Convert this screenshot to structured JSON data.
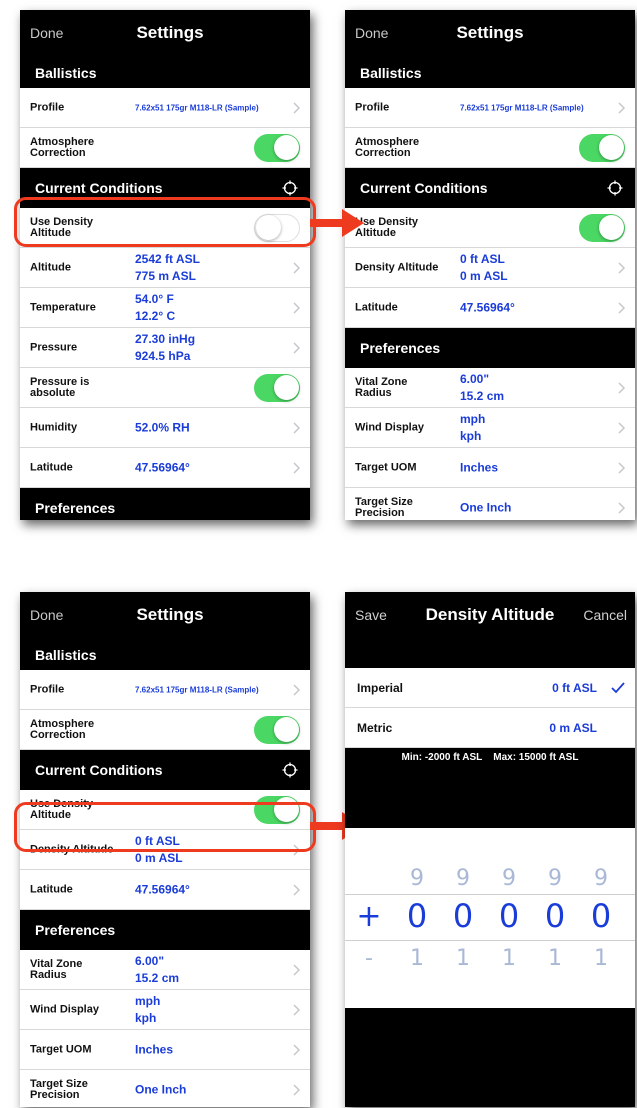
{
  "settings": {
    "done_label": "Done",
    "title": "Settings",
    "ballistics_header": "Ballistics",
    "profile_label": "Profile",
    "profile_value": "7.62x51 175gr M118-LR (Sample)",
    "atmosphere_label": "Atmosphere Correction",
    "current_conditions_header": "Current Conditions",
    "use_density_label": "Use Density Altitude",
    "altitude_label": "Altitude",
    "altitude_ft": "2542 ft ASL",
    "altitude_m": "775 m ASL",
    "temperature_label": "Temperature",
    "temperature_f": "54.0° F",
    "temperature_c": "12.2° C",
    "pressure_label": "Pressure",
    "pressure_inhg": "27.30 inHg",
    "pressure_hpa": "924.5 hPa",
    "pressure_absolute_label": "Pressure is absolute",
    "humidity_label": "Humidity",
    "humidity_value": "52.0% RH",
    "latitude_label": "Latitude",
    "latitude_value": "47.56964°",
    "preferences_header": "Preferences",
    "density_altitude_label": "Density Altitude",
    "density_ft": "0 ft ASL",
    "density_m": "0 m ASL",
    "vital_zone_label": "Vital Zone Radius",
    "vital_zone_in": "6.00\"",
    "vital_zone_cm": "15.2 cm",
    "wind_display_label": "Wind Display",
    "wind_mph": "mph",
    "wind_kph": "kph",
    "target_uom_label": "Target UOM",
    "target_uom_value": "Inches",
    "target_size_label": "Target Size Precision",
    "target_size_value": "One Inch",
    "toggles": {
      "atmosphere": true,
      "use_density_panel1": false,
      "use_density_panel2": true,
      "pressure_absolute": true
    }
  },
  "density_screen": {
    "save_label": "Save",
    "title": "Density Altitude",
    "cancel_label": "Cancel",
    "imperial_label": "Imperial",
    "imperial_value": "0 ft ASL",
    "metric_label": "Metric",
    "metric_value": "0 m ASL",
    "min_label": "Min: -2000 ft ASL",
    "max_label": "Max: 15000 ft ASL",
    "picker": {
      "above": [
        "9",
        "9",
        "9",
        "9",
        "9"
      ],
      "sign_selected": "+",
      "selected": [
        "0",
        "0",
        "0",
        "0",
        "0"
      ],
      "sign_below": "-",
      "below": [
        "1",
        "1",
        "1",
        "1",
        "1"
      ]
    }
  },
  "colors": {
    "accent_value": "#1a3cd8",
    "toggle_on": "#4bd763",
    "highlight": "#ee3a1f"
  }
}
